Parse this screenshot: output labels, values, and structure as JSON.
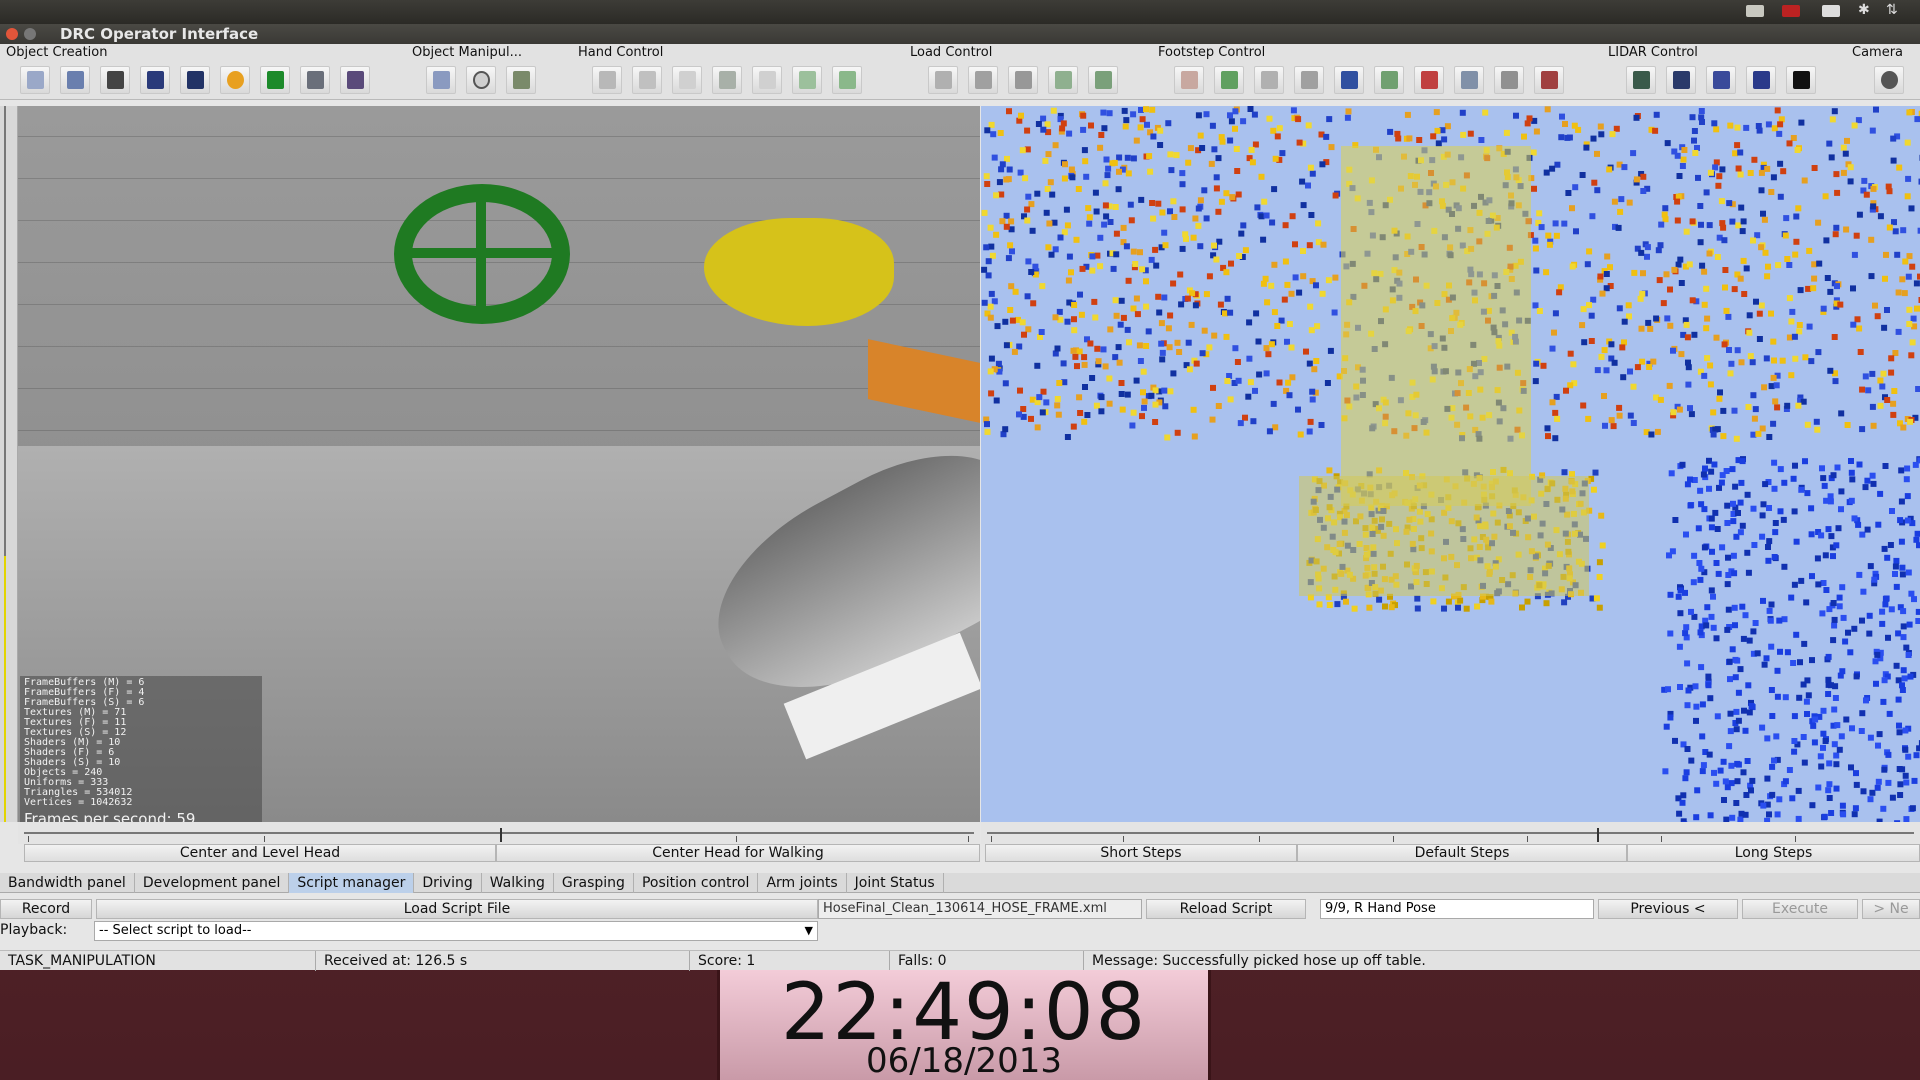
{
  "window": {
    "title": "DRC Operator Interface"
  },
  "toolbar": {
    "groups": [
      {
        "label": "Object Creation"
      },
      {
        "label": "Object Manipul..."
      },
      {
        "label": "Hand Control"
      },
      {
        "label": "Load Control"
      },
      {
        "label": "Footstep Control"
      },
      {
        "label": "LIDAR Control"
      },
      {
        "label": "Camera"
      }
    ]
  },
  "stats": {
    "lines": [
      "FrameBuffers (M) = 6",
      "FrameBuffers (F) = 4",
      "FrameBuffers (S) = 6",
      "Textures (M) = 71",
      "Textures (F) = 11",
      "Textures (S) = 12",
      "Shaders (M) = 10",
      "Shaders (F) = 6",
      "Shaders (S) = 10",
      "Objects = 240",
      "Uniforms = 333",
      "Triangles = 534012",
      "Vertices = 1042632"
    ],
    "fps": "Frames per second: 59"
  },
  "head_buttons": {
    "center_level": "Center and Level Head",
    "center_walking": "Center Head for Walking"
  },
  "step_buttons": {
    "short": "Short Steps",
    "default": "Default Steps",
    "long": "Long Steps"
  },
  "tabs": [
    "Bandwidth panel",
    "Development panel",
    "Script manager",
    "Driving",
    "Walking",
    "Grasping",
    "Position control",
    "Arm joints",
    "Joint Status"
  ],
  "script": {
    "record": "Record",
    "load_script_file": "Load Script File",
    "filename": "HoseFinal_Clean_130614_HOSE_FRAME.xml",
    "reload": "Reload Script",
    "step": "9/9, R Hand Pose",
    "previous": "Previous <",
    "execute": "Execute",
    "next": "> Ne",
    "playback_label": "Playback:",
    "select_placeholder": "-- Select script to load--"
  },
  "status": {
    "task": "TASK_MANIPULATION",
    "received": "Received at:  126.5 s",
    "score": "Score:  1",
    "falls": "Falls:  0",
    "message": "Message:  Successfully picked hose up off table."
  },
  "clock": {
    "time": "22:49:08",
    "date": "06/18/2013"
  }
}
